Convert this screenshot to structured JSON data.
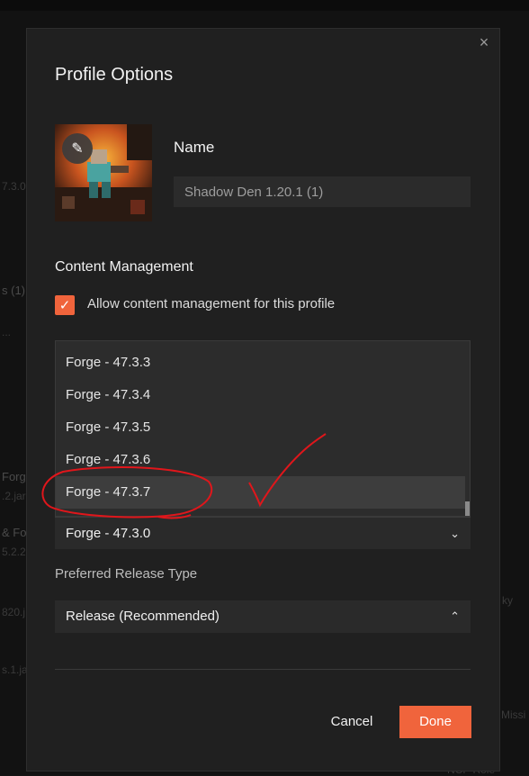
{
  "background": {
    "fragments": [
      "7.3.0",
      "s (1)",
      "...",
      "Forg",
      ".2.jar",
      "& Fo",
      "5.2.2",
      "820.j",
      "s.1.ja",
      "ky",
      "Missi",
      "NCP Role"
    ]
  },
  "dialog": {
    "title": "Profile Options",
    "close_icon": "×",
    "avatar": {
      "edit_icon": "pencil-icon",
      "edit_glyph": "✎"
    },
    "name_label": "Name",
    "name_value": "Shadow Den 1.20.1 (1)",
    "content_management": {
      "title": "Content Management",
      "checkbox_checked": true,
      "checkbox_glyph": "✓",
      "checkbox_label": "Allow content management for this profile"
    },
    "version_dropdown": {
      "options": [
        "Forge - 47.3.3",
        "Forge - 47.3.4",
        "Forge - 47.3.5",
        "Forge - 47.3.6",
        "Forge - 47.3.7"
      ],
      "hovered_option": "Forge - 47.3.7",
      "selected_value": "Forge - 47.3.0",
      "chevron_glyph": "⌄"
    },
    "release_type": {
      "label": "Preferred Release Type",
      "value": "Release (Recommended)",
      "chevron_glyph": "⌃"
    },
    "buttons": {
      "cancel": "Cancel",
      "done": "Done"
    }
  },
  "colors": {
    "accent": "#f0643c",
    "dialog_bg": "#202020",
    "input_bg": "#2b2b2b",
    "annotation_red": "#e0161b"
  }
}
